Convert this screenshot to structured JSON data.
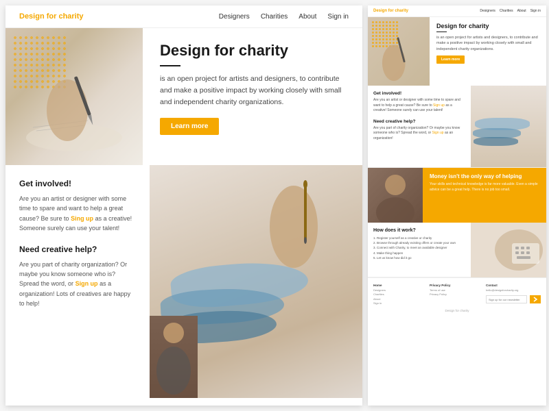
{
  "left_panel": {
    "header": {
      "logo": "Design for charity",
      "nav": [
        "Designers",
        "Charities",
        "About",
        "Sign in"
      ]
    },
    "hero": {
      "title": "Design for charity",
      "description": "is an open project for artists and designers, to contribute and make a positive impact by working closely with small and independent charity organizations.",
      "cta_button": "Learn more"
    },
    "get_involved": {
      "title": "Get involved!",
      "text_1": "Are you an artist or designer with some time to spare and want to help a great cause? Be sure to",
      "link_1": "Sing up",
      "text_2": "as a creative! Someone surely can use your talent!"
    },
    "need_help": {
      "title": "Need creative help?",
      "text_1": "Are you part of charity organization? Or maybe you know someone who is? Spread the word, or",
      "link_1": "Sign up",
      "text_2": "as a organization! Lots of creatives are happy to help!"
    }
  },
  "right_panel": {
    "header": {
      "logo": "Design for charity",
      "nav": [
        "Designers",
        "Charities",
        "About",
        "Sign in"
      ]
    },
    "hero": {
      "title": "Design for charity",
      "description": "is an open project for artists and designers, to contribute and make a positive impact by working closely with small and independent charity organizations.",
      "cta_button": "Learn more"
    },
    "get_involved": {
      "title": "Get involved!",
      "text": "Are you an artist or designer with some time to spare and want to help a great cause? Be sure to Sign up as a creative!"
    },
    "need_help": {
      "title": "Need creative help?",
      "text": "Are you part of charity organization? Or maybe you know someone who is? Spread the word, or Sign up as an organization!"
    },
    "money_section": {
      "title": "Money isn't the only way of helping",
      "text": "Your skills and technical knowledge is far more valuable. Even a simple advice can be a great help. There is no job too small."
    },
    "how_it_works": {
      "title": "How does it work?",
      "steps": [
        "1. Register yourself as a creative or charity",
        "2. Browse through already existing offers or create your own",
        "3. Connect with Charity, to meet an available designer",
        "4. Make thing happen",
        "5. Let us know how did it go"
      ]
    },
    "footer": {
      "cols": [
        {
          "title": "Home",
          "links": [
            "Designers",
            "Charities",
            "About",
            "Sign in"
          ]
        },
        {
          "title": "Privacy Policy",
          "links": [
            "Terms of use",
            "Privacy Policy"
          ]
        },
        {
          "title": "Contact",
          "links": [
            "hello@designforcharity.org"
          ]
        }
      ],
      "newsletter_placeholder": "Sign up for our newsletter",
      "brand": "Design for charity"
    }
  }
}
